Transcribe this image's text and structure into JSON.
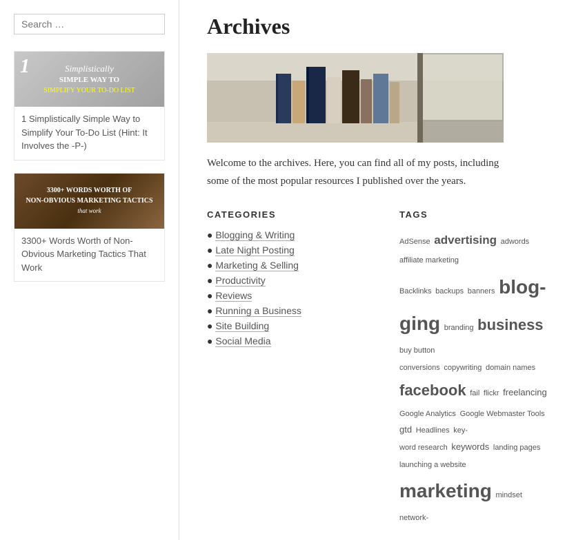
{
  "sidebar": {
    "search_placeholder": "Search …",
    "posts": [
      {
        "id": "post-1",
        "number": "1",
        "image_lines": [
          "Simplistically",
          "Simple Way to",
          "Simplify YOUR TO-DO LIST"
        ],
        "title": "1 Simplistically Simple Way to Simplify Your To-Do List (Hint: It Involves the -P-)"
      },
      {
        "id": "post-2",
        "image_lines": [
          "3300+ WORDS WORTH OF",
          "NON-OBVIOUS MARKETING TACTICS",
          "that work"
        ],
        "title": "3300+ Words Worth of Non-Obvious Marketing Tactics That Work"
      }
    ]
  },
  "main": {
    "page_title": "Archives",
    "welcome_text": "Welcome to the archives. Here, you can find all of my posts, including some of the most popular resources I published over the years.",
    "categories_heading": "CATEGORIES",
    "categories": [
      "Blogging & Writing",
      "Late Night Posting",
      "Marketing & Selling",
      "Productivity",
      "Reviews",
      "Running a Business",
      "Site Building",
      "Social Media"
    ],
    "tags_heading": "TAGS",
    "tags": [
      {
        "text": "AdSense",
        "size": "sm"
      },
      {
        "text": "advertising",
        "size": "lg"
      },
      {
        "text": "adwords",
        "size": "md"
      },
      {
        "text": "affiliate marketing",
        "size": "md"
      },
      {
        "text": "Backlinks",
        "size": "md"
      },
      {
        "text": "backups",
        "size": "sm"
      },
      {
        "text": "banners",
        "size": "sm"
      },
      {
        "text": "blogging",
        "size": "xxl"
      },
      {
        "text": "branding",
        "size": "sm"
      },
      {
        "text": "business",
        "size": "xl"
      },
      {
        "text": "buy button",
        "size": "sm"
      },
      {
        "text": "conversions",
        "size": "sm"
      },
      {
        "text": "copywriting",
        "size": "sm"
      },
      {
        "text": "domain names",
        "size": "sm"
      },
      {
        "text": "facebook",
        "size": "xl"
      },
      {
        "text": "fail",
        "size": "sm"
      },
      {
        "text": "flickr",
        "size": "sm"
      },
      {
        "text": "freelancing",
        "size": "md"
      },
      {
        "text": "Google Analytics",
        "size": "sm"
      },
      {
        "text": "Google Webmaster Tools",
        "size": "sm"
      },
      {
        "text": "gtd",
        "size": "md"
      },
      {
        "text": "Headlines",
        "size": "sm"
      },
      {
        "text": "keyword research",
        "size": "sm"
      },
      {
        "text": "keywords",
        "size": "md"
      },
      {
        "text": "landing pages",
        "size": "sm"
      },
      {
        "text": "launching a website",
        "size": "sm"
      },
      {
        "text": "marketing",
        "size": "xxl"
      },
      {
        "text": "mindset",
        "size": "sm"
      },
      {
        "text": "network-",
        "size": "sm"
      }
    ]
  }
}
